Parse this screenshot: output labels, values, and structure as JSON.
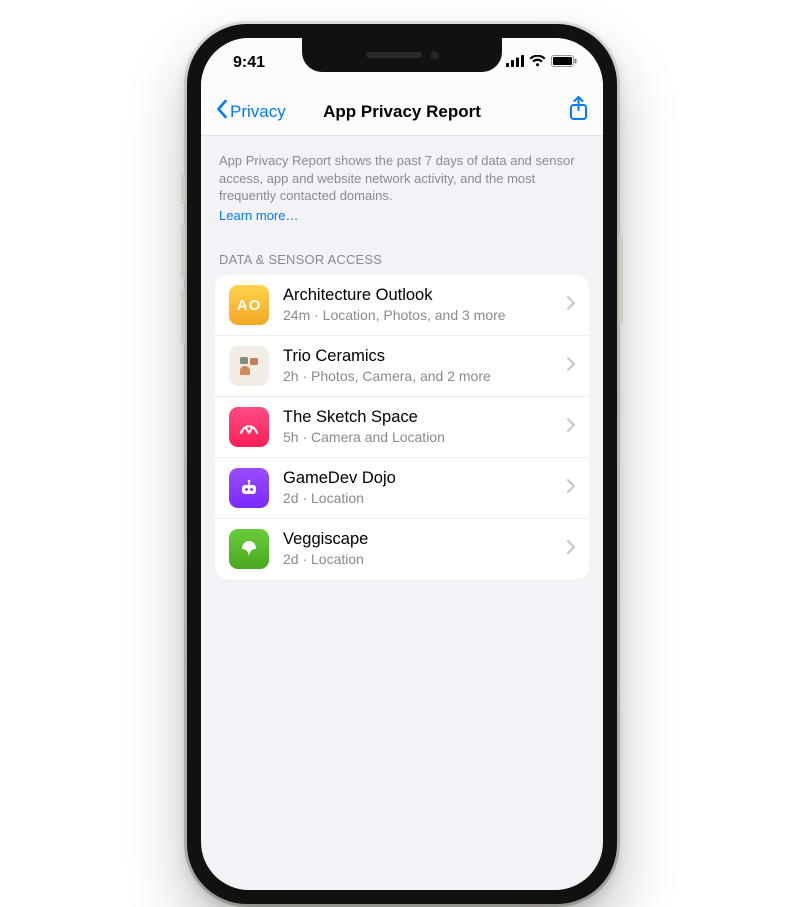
{
  "status": {
    "time": "9:41"
  },
  "nav": {
    "back_label": "Privacy",
    "title": "App Privacy Report"
  },
  "intro": {
    "text": "App Privacy Report shows the past 7 days of data and sensor access, app and website network activity, and the most frequently contacted domains.",
    "learn_more": "Learn more…"
  },
  "section_header": "DATA & SENSOR ACCESS",
  "apps": [
    {
      "name": "Architecture Outlook",
      "sub": "24m · Location, Photos, and 3 more",
      "glyph": "AO"
    },
    {
      "name": "Trio Ceramics",
      "sub": "2h · Photos, Camera, and 2 more"
    },
    {
      "name": "The Sketch Space",
      "sub": "5h · Camera and Location"
    },
    {
      "name": "GameDev Dojo",
      "sub": "2d · Location"
    },
    {
      "name": "Veggiscape",
      "sub": "2d · Location"
    }
  ],
  "colors": {
    "accent": "#007aff"
  }
}
